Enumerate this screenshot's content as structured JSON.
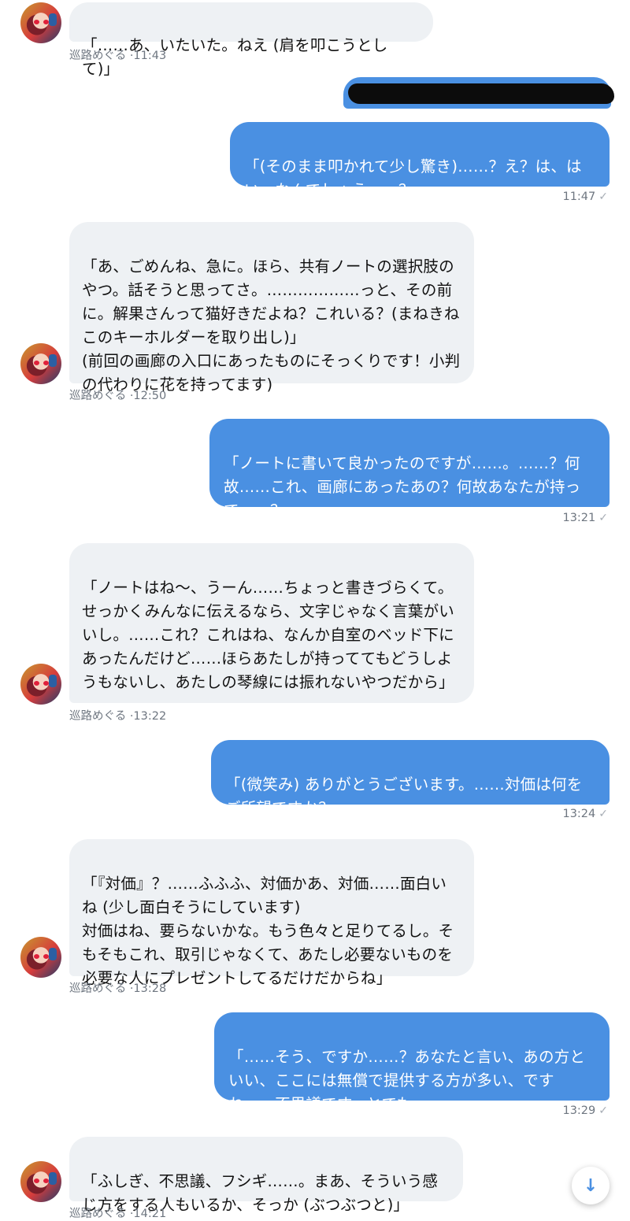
{
  "messages": [
    {
      "side": "in",
      "text": "「……あ、いたいた。ねえ (肩を叩こうとして)」",
      "sender": "巡路めぐる",
      "time": "·11:43"
    },
    {
      "side": "out",
      "text": "「(そのまま叩かれて少し驚き)……？え？は、はい、なんでしょう……？」",
      "time": "11:47",
      "status": "✓"
    },
    {
      "side": "in",
      "text": "「あ、ごめんね、急に。ほら、共有ノートの選択肢のやつ。話そうと思ってさ。………………っと、その前に。解果さんって猫好きだよね？これいる？(まねきねこのキーホルダーを取り出し)」\n(前回の画廊の入口にあったものにそっくりです！小判の代わりに花を持ってます)",
      "sender": "巡路めぐる",
      "time": "·12:50"
    },
    {
      "side": "out",
      "text": "「ノートに書いて良かったのですが……。……？何故……これ、画廊にあったあの？何故あなたが持って……？」",
      "time": "13:21",
      "status": "✓"
    },
    {
      "side": "in",
      "text": "「ノートはね〜、うーん……ちょっと書きづらくて。せっかくみんなに伝えるなら、文字じゃなく言葉がいいし。……これ？これはね、なんか自室のベッド下にあったんだけど……ほらあたしが持っててもどうしようもないし、あたしの琴線には振れないやつだから」",
      "sender": "巡路めぐる",
      "time": "·13:22"
    },
    {
      "side": "out",
      "text": "「(微笑み) ありがとうございます。……対価は何をご所望ですか？」",
      "time": "13:24",
      "status": "✓"
    },
    {
      "side": "in",
      "text": "「『対価』？……ふふふ、対価かあ、対価……面白いね (少し面白そうにしています)\n対価はね、要らないかな。もう色々と足りてるし。そもそもこれ、取引じゃなくて、あたし必要ないものを必要な人にプレゼントしてるだけだからね」",
      "sender": "巡路めぐる",
      "time": "·13:28"
    },
    {
      "side": "out",
      "text": "「……そう、ですか……？あなたと言い、あの方といい、ここには無償で提供する方が多い、ですね……不思議です。とても」",
      "time": "13:29",
      "status": "✓"
    },
    {
      "side": "in",
      "text": "「ふしぎ、不思議、フシギ……。まあ、そういう感じ方をする人もいるか、そっか (ぶつぶつと)」",
      "sender": "巡路めぐる",
      "time": "·14:21"
    }
  ],
  "scroll_button": {
    "icon": "↓"
  },
  "colors": {
    "incoming": "#eef1f4",
    "outgoing": "#4a90e2",
    "meta": "#6e7680"
  }
}
